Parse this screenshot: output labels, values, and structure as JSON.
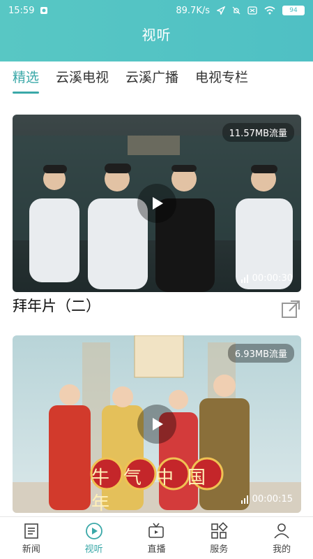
{
  "status_bar": {
    "time": "15:59",
    "network_speed": "89.7K/s",
    "battery_level": "94"
  },
  "header": {
    "title": "视听"
  },
  "tabs": [
    {
      "label": "精选",
      "active": true
    },
    {
      "label": "云溪电视",
      "active": false
    },
    {
      "label": "云溪广播",
      "active": false
    },
    {
      "label": "电视专栏",
      "active": false
    }
  ],
  "videos": [
    {
      "title": "拜年片（二）",
      "data_usage": "11.57MB流量",
      "duration": "00:00:30",
      "share_icon": "share-icon"
    },
    {
      "title": "",
      "data_usage": "6.93MB流量",
      "duration": "00:00:15",
      "banner_text": "牛气中国年"
    }
  ],
  "bottom_nav": [
    {
      "label": "新闻",
      "icon": "news-icon",
      "active": false
    },
    {
      "label": "视听",
      "icon": "play-circle-icon",
      "active": true
    },
    {
      "label": "直播",
      "icon": "tv-icon",
      "active": false
    },
    {
      "label": "服务",
      "icon": "apps-icon",
      "active": false
    },
    {
      "label": "我的",
      "icon": "user-icon",
      "active": false
    }
  ]
}
